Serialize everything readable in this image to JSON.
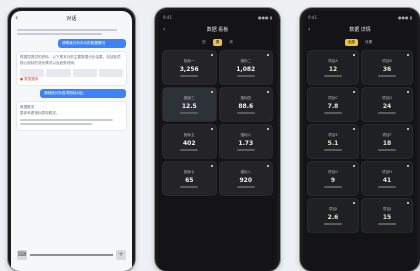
{
  "phone1": {
    "title": "对话",
    "back": "‹",
    "user_msg_1": "请帮我分析本月的数据情况",
    "user_msg_2": "请继续分析各项指标对比",
    "assistant_text_1": "根据您提供的资料，以下是本月的主要数据分析结果，包括各项核心指标的变化情况以及趋势说明。",
    "assistant_text_2": "整体来看指标表现稳定。",
    "accent_note": "● 数据更新",
    "card_title": "数据概览"
  },
  "phone2": {
    "status_left": "9:41",
    "status_right": "●●● ▮",
    "back": "‹",
    "title": "数据 看板",
    "tabs": [
      "日",
      "周",
      "月"
    ],
    "active_tab": "周",
    "tiles": [
      {
        "name": "指标一",
        "value": "3,256"
      },
      {
        "name": "指标二",
        "value": "1,082"
      },
      {
        "name": "指标三",
        "value": "12.5"
      },
      {
        "name": "指标四",
        "value": "88.6"
      },
      {
        "name": "指标五",
        "value": "402"
      },
      {
        "name": "指标六",
        "value": "1.73"
      },
      {
        "name": "指标七",
        "value": "65"
      },
      {
        "name": "指标八",
        "value": "920"
      }
    ]
  },
  "phone3": {
    "status_left": "9:41",
    "status_right": "●●● ▮",
    "back": "‹",
    "title": "数据 详情",
    "tabs": [
      "全部",
      "分类"
    ],
    "active_tab": "全部",
    "tiles": [
      {
        "name": "项目A",
        "value": "12"
      },
      {
        "name": "项目B",
        "value": "36"
      },
      {
        "name": "项目C",
        "value": "7.8"
      },
      {
        "name": "项目D",
        "value": "24"
      },
      {
        "name": "项目E",
        "value": "5.1"
      },
      {
        "name": "项目F",
        "value": "18"
      },
      {
        "name": "项目G",
        "value": "9"
      },
      {
        "name": "项目H",
        "value": "41"
      },
      {
        "name": "项目I",
        "value": "2.6"
      },
      {
        "name": "项目J",
        "value": "15"
      }
    ]
  }
}
